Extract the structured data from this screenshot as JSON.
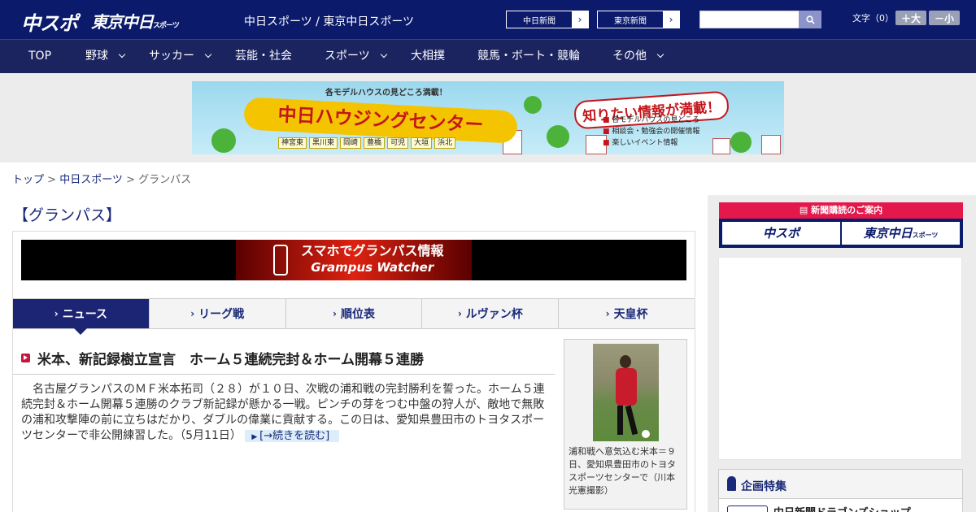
{
  "header": {
    "logo_chusupo": "中スポ",
    "logo_tokyo": "東京中日",
    "logo_tokyo_suffix": "スポーツ",
    "site_name": "中日スポーツ / 東京中日スポーツ",
    "btn_chunichi": "中日新聞",
    "btn_tokyo": "東京新聞",
    "search": {
      "placeholder": ""
    },
    "font_label": "文字（0）",
    "font_big": "＋大",
    "font_small": "－小"
  },
  "nav": [
    {
      "label": "TOP",
      "dropdown": false
    },
    {
      "label": "野球",
      "dropdown": true
    },
    {
      "label": "サッカー",
      "dropdown": true
    },
    {
      "label": "芸能・社会",
      "dropdown": false
    },
    {
      "label": "スポーツ",
      "dropdown": true
    },
    {
      "label": "大相撲",
      "dropdown": false
    },
    {
      "label": "競馬・ボート・競輪",
      "dropdown": false
    },
    {
      "label": "その他",
      "dropdown": true
    }
  ],
  "ad_banner": {
    "top_text": "各モデルハウスの見どころ満載！",
    "title": "中日ハウジングセンター",
    "cities": [
      "神宮東",
      "黒川東",
      "岡崎",
      "豊橋",
      "可児",
      "大垣",
      "浜北"
    ],
    "catch": "知りたい情報が満載！",
    "list": [
      "各モデルハウスの見どころ",
      "相談会・勉強会の開催情報",
      "楽しいイベント情報"
    ]
  },
  "breadcrumb": {
    "top": "トップ",
    "sep1": " > ",
    "section": "中日スポーツ",
    "sep2": " > ",
    "current": "グランパス"
  },
  "page_title": "【グランパス】",
  "grampus_banner": {
    "line1": "スマホでグランパス情報",
    "line2": "Grampus Watcher"
  },
  "tabs": [
    {
      "label": "ニュース",
      "active": true
    },
    {
      "label": "リーグ戦",
      "active": false
    },
    {
      "label": "順位表",
      "active": false
    },
    {
      "label": "ルヴァン杯",
      "active": false
    },
    {
      "label": "天皇杯",
      "active": false
    }
  ],
  "article": {
    "title": "米本、新記録樹立宣言　ホーム５連続完封＆ホーム開幕５連勝",
    "body": "名古屋グランパスのＭＦ米本拓司（２８）が１０日、次戦の浦和戦の完封勝利を誓った。ホーム５連続完封＆ホーム開幕５連勝のクラブ新記録が懸かる一戦。ピンチの芽をつむ中盤の狩人が、敵地で無敗の浦和攻撃陣の前に立ちはだかり、ダブルの偉業に貢献する。この日は、愛知県豊田市のトヨタスポーツセンターで非公開練習した。",
    "date": "（5月11日）",
    "more": "[→続きを読む]",
    "photo_caption": "浦和戦へ意気込む米本＝９日、愛知県豊田市のトヨタスポーツセンターで（川本光憲撮影）"
  },
  "sidebar": {
    "subscription_top": "新聞購読のご案内",
    "logo1": "中スポ",
    "logo2": "東京中日",
    "logo2_suffix": "スポーツ",
    "feature_title": "企画特集",
    "feature_item": "中日新聞ドラゴンズショップ"
  },
  "colors": {
    "header_bg": "#0b1a6b",
    "nav_bg": "#1c2460",
    "accent_red": "#e5184c",
    "link": "#1a2a7a"
  }
}
